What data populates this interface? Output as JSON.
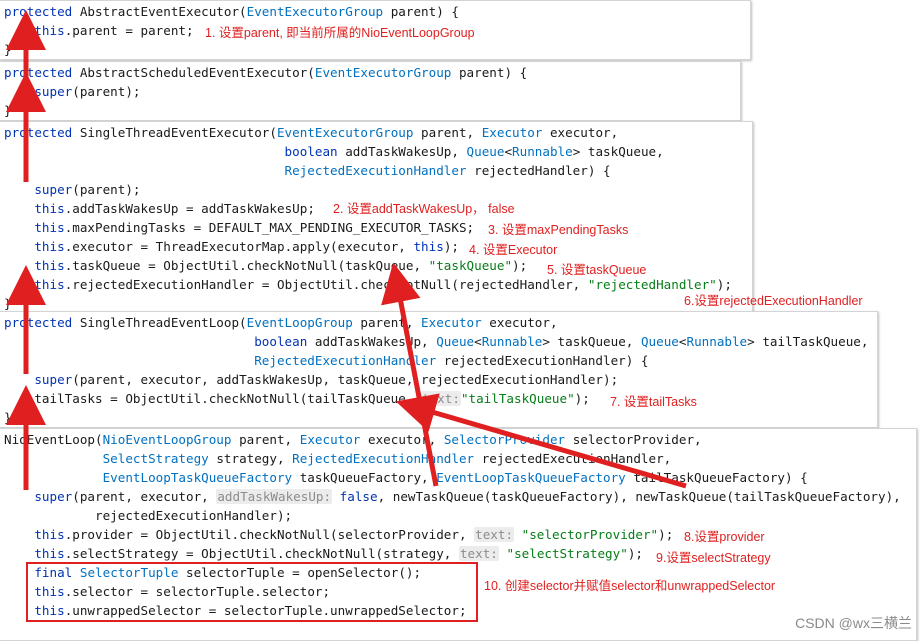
{
  "panels": [
    {
      "lines": [
        [
          [
            "kw",
            "protected"
          ],
          [
            "t",
            " AbstractEventExecutor("
          ],
          [
            "ty",
            "EventExecutorGroup"
          ],
          [
            "t",
            " parent) {"
          ]
        ],
        [
          [
            "t",
            "    "
          ],
          [
            "kw",
            "this"
          ],
          [
            "t",
            ".parent = parent;"
          ]
        ],
        [
          [
            "t",
            "}"
          ]
        ]
      ]
    },
    {
      "lines": [
        [
          [
            "kw",
            "protected"
          ],
          [
            "t",
            " AbstractScheduledEventExecutor("
          ],
          [
            "ty",
            "EventExecutorGroup"
          ],
          [
            "t",
            " parent) {"
          ]
        ],
        [
          [
            "t",
            "    "
          ],
          [
            "kw",
            "super"
          ],
          [
            "t",
            "(parent);"
          ]
        ],
        [
          [
            "t",
            "}"
          ]
        ]
      ]
    },
    {
      "lines": [
        [
          [
            "kw",
            "protected"
          ],
          [
            "t",
            " SingleThreadEventExecutor("
          ],
          [
            "ty",
            "EventExecutorGroup"
          ],
          [
            "t",
            " parent, "
          ],
          [
            "ty",
            "Executor"
          ],
          [
            "t",
            " executor,"
          ]
        ],
        [
          [
            "t",
            "                                     "
          ],
          [
            "kw",
            "boolean"
          ],
          [
            "t",
            " addTaskWakesUp, "
          ],
          [
            "ty",
            "Queue"
          ],
          [
            "t",
            "<"
          ],
          [
            "ty",
            "Runnable"
          ],
          [
            "t",
            "> taskQueue,"
          ]
        ],
        [
          [
            "t",
            "                                     "
          ],
          [
            "ty",
            "RejectedExecutionHandler"
          ],
          [
            "t",
            " rejectedHandler) {"
          ]
        ],
        [
          [
            "t",
            "    "
          ],
          [
            "kw",
            "super"
          ],
          [
            "t",
            "(parent);"
          ]
        ],
        [
          [
            "t",
            "    "
          ],
          [
            "kw",
            "this"
          ],
          [
            "t",
            ".addTaskWakesUp = addTaskWakesUp;"
          ]
        ],
        [
          [
            "t",
            "    "
          ],
          [
            "kw",
            "this"
          ],
          [
            "t",
            ".maxPendingTasks = DEFAULT_MAX_PENDING_EXECUTOR_TASKS;"
          ]
        ],
        [
          [
            "t",
            "    "
          ],
          [
            "kw",
            "this"
          ],
          [
            "t",
            ".executor = ThreadExecutorMap.apply(executor, "
          ],
          [
            "kw",
            "this"
          ],
          [
            "t",
            ");"
          ]
        ],
        [
          [
            "t",
            "    "
          ],
          [
            "kw",
            "this"
          ],
          [
            "t",
            ".taskQueue = ObjectUtil.checkNotNull(taskQueue, "
          ],
          [
            "str",
            "\"taskQueue\""
          ],
          [
            "t",
            ");"
          ]
        ],
        [
          [
            "t",
            "    "
          ],
          [
            "kw",
            "this"
          ],
          [
            "t",
            ".rejectedExecutionHandler = ObjectUtil.checkNotNull(rejectedHandler, "
          ],
          [
            "str",
            "\"rejectedHandler\""
          ],
          [
            "t",
            ");"
          ]
        ],
        [
          [
            "t",
            "}"
          ]
        ]
      ]
    },
    {
      "lines": [
        [
          [
            "kw",
            "protected"
          ],
          [
            "t",
            " SingleThreadEventLoop("
          ],
          [
            "ty",
            "EventLoopGroup"
          ],
          [
            "t",
            " parent, "
          ],
          [
            "ty",
            "Executor"
          ],
          [
            "t",
            " executor,"
          ]
        ],
        [
          [
            "t",
            "                                 "
          ],
          [
            "kw",
            "boolean"
          ],
          [
            "t",
            " addTaskWakesUp, "
          ],
          [
            "ty",
            "Queue"
          ],
          [
            "t",
            "<"
          ],
          [
            "ty",
            "Runnable"
          ],
          [
            "t",
            "> taskQueue, "
          ],
          [
            "ty",
            "Queue"
          ],
          [
            "t",
            "<"
          ],
          [
            "ty",
            "Runnable"
          ],
          [
            "t",
            "> tailTaskQueue,"
          ]
        ],
        [
          [
            "t",
            "                                 "
          ],
          [
            "ty",
            "RejectedExecutionHandler"
          ],
          [
            "t",
            " rejectedExecutionHandler) {"
          ]
        ],
        [
          [
            "t",
            "    "
          ],
          [
            "kw",
            "super"
          ],
          [
            "t",
            "(parent, executor, addTaskWakesUp, taskQueue, rejectedExecutionHandler);"
          ]
        ],
        [
          [
            "t",
            "    tailTasks = ObjectUtil.checkNotNull(tailTaskQueue, "
          ],
          [
            "hint",
            "text:"
          ],
          [
            "str",
            "\"tailTaskQueue\""
          ],
          [
            "t",
            ");"
          ]
        ],
        [
          [
            "t",
            "}"
          ]
        ]
      ]
    },
    {
      "lines": [
        [
          [
            "t",
            "NioEventLoop("
          ],
          [
            "ty",
            "NioEventLoopGroup"
          ],
          [
            "t",
            " parent, "
          ],
          [
            "ty",
            "Executor"
          ],
          [
            "t",
            " executor, "
          ],
          [
            "ty",
            "SelectorProvider"
          ],
          [
            "t",
            " selectorProvider,"
          ]
        ],
        [
          [
            "t",
            "             "
          ],
          [
            "ty",
            "SelectStrategy"
          ],
          [
            "t",
            " strategy, "
          ],
          [
            "ty",
            "RejectedExecutionHandler"
          ],
          [
            "t",
            " rejectedExecutionHandler,"
          ]
        ],
        [
          [
            "t",
            "             "
          ],
          [
            "ty",
            "EventLoopTaskQueueFactory"
          ],
          [
            "t",
            " taskQueueFactory, "
          ],
          [
            "ty",
            "EventLoopTaskQueueFactory"
          ],
          [
            "t",
            " tailTaskQueueFactory) {"
          ]
        ],
        [
          [
            "t",
            "    "
          ],
          [
            "kw",
            "super"
          ],
          [
            "t",
            "(parent, executor, "
          ],
          [
            "hint",
            "addTaskWakesUp:"
          ],
          [
            "t",
            " "
          ],
          [
            "kw",
            "false"
          ],
          [
            "t",
            ", newTaskQueue(taskQueueFactory), newTaskQueue(tailTaskQueueFactory),"
          ]
        ],
        [
          [
            "t",
            "            rejectedExecutionHandler);"
          ]
        ],
        [
          [
            "t",
            "    "
          ],
          [
            "kw",
            "this"
          ],
          [
            "t",
            ".provider = ObjectUtil.checkNotNull(selectorProvider, "
          ],
          [
            "hint",
            "text:"
          ],
          [
            "t",
            " "
          ],
          [
            "str",
            "\"selectorProvider\""
          ],
          [
            "t",
            ");"
          ]
        ],
        [
          [
            "t",
            "    "
          ],
          [
            "kw",
            "this"
          ],
          [
            "t",
            ".selectStrategy = ObjectUtil.checkNotNull(strategy, "
          ],
          [
            "hint",
            "text:"
          ],
          [
            "t",
            " "
          ],
          [
            "str",
            "\"selectStrategy\""
          ],
          [
            "t",
            ");"
          ]
        ],
        [
          [
            "t",
            "    "
          ],
          [
            "kw",
            "final"
          ],
          [
            "t",
            " "
          ],
          [
            "ty",
            "SelectorTuple"
          ],
          [
            "t",
            " selectorTuple = openSelector();"
          ]
        ],
        [
          [
            "t",
            "    "
          ],
          [
            "kw",
            "this"
          ],
          [
            "t",
            ".selector = selectorTuple.selector;"
          ]
        ],
        [
          [
            "t",
            "    "
          ],
          [
            "kw",
            "this"
          ],
          [
            "t",
            ".unwrappedSelector = selectorTuple.unwrappedSelector;"
          ]
        ]
      ]
    }
  ],
  "annotations": {
    "a1": "1. 设置parent, 即当前所属的NioEventLoopGroup",
    "a2": "2. 设置addTaskWakesUp，  false",
    "a3": "3. 设置maxPendingTasks",
    "a4": "4. 设置Executor",
    "a5": "5. 设置taskQueue",
    "a6": "6.设置rejectedExecutionHandler",
    "a7": "7. 设置tailTasks",
    "a8": "8.设置provider",
    "a9": "9.设置selectStrategy",
    "a10": "10. 创建selector并赋值selector和unwrappedSelector"
  },
  "watermark": "CSDN @wx三横兰",
  "colors": {
    "keyword": "#0033b3",
    "type": "#0070c1",
    "string": "#067d17",
    "annotation": "#e02020"
  }
}
